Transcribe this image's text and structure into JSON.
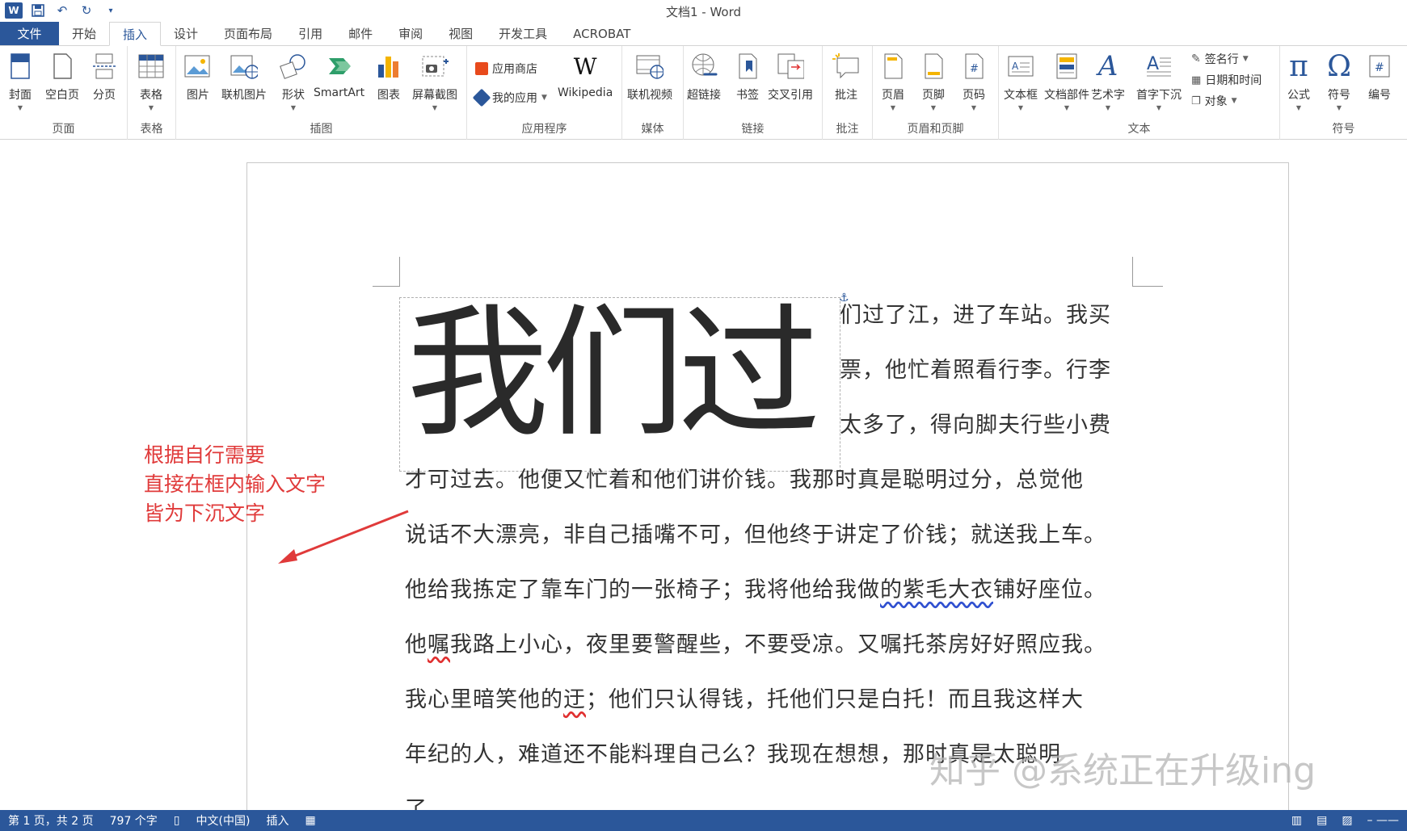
{
  "window": {
    "title": "文档1 - Word"
  },
  "tabs": [
    "文件",
    "开始",
    "插入",
    "设计",
    "页面布局",
    "引用",
    "邮件",
    "审阅",
    "视图",
    "开发工具",
    "ACROBAT"
  ],
  "active_tab": "插入",
  "ribbon": {
    "page_group": {
      "label": "页面",
      "cover": "封面",
      "blank": "空白页",
      "break": "分页"
    },
    "table_group": {
      "label": "表格",
      "table": "表格"
    },
    "illus_group": {
      "label": "插图",
      "picture": "图片",
      "online_picture": "联机图片",
      "shapes": "形状",
      "smartart": "SmartArt",
      "chart": "图表",
      "screenshot": "屏幕截图"
    },
    "apps_group": {
      "label": "应用程序",
      "store": "应用商店",
      "my_apps": "我的应用",
      "wikipedia": "Wikipedia"
    },
    "media_group": {
      "label": "媒体",
      "online_video": "联机视频"
    },
    "links_group": {
      "label": "链接",
      "hyperlink": "超链接",
      "bookmark": "书签",
      "cross_ref": "交叉引用"
    },
    "comments_group": {
      "label": "批注",
      "comment": "批注"
    },
    "hf_group": {
      "label": "页眉和页脚",
      "header": "页眉",
      "footer": "页脚",
      "page_number": "页码"
    },
    "text_group": {
      "label": "文本",
      "textbox": "文本框",
      "quick_parts": "文档部件",
      "wordart": "艺术字",
      "dropcap": "首字下沉",
      "signature": "签名行",
      "datetime": "日期和时间",
      "object": "对象"
    },
    "symbols_group": {
      "label": "符号",
      "equation": "公式",
      "symbol": "符号",
      "number": "编号"
    }
  },
  "document": {
    "dropcap_text": "我们过",
    "lines": [
      "们过了江，进了车站。我买",
      "票，他忙着照看行李。行李",
      "太多了，得向脚夫行些小费",
      "才可过去。他便又忙着和他们讲价钱。我那时真是聪明过分，总觉他",
      "说话不大漂亮，非自己插嘴不可，但他终于讲定了价钱；就送我上车。",
      "他给我拣定了靠车门的一张椅子；我将他给我做",
      "的紫毛大衣",
      "铺好座位。",
      "他",
      "嘱",
      "我路上小心，夜里要警醒些，不要受凉。又嘱托茶房好好照应我。",
      "我心里暗笑他的",
      "迂",
      "；他们只认得钱，托他们只是白托！而且我这样大",
      "年纪的人，难道还不能料理自己么？我现在想想，那时真是太聪明",
      "了。"
    ]
  },
  "annotation": {
    "line1": "根据自行需要",
    "line2": "直接在框内输入文字",
    "line3": "皆为下沉文字"
  },
  "watermark": "知乎 @系统正在升级ing",
  "status": {
    "page": "第 1 页，共 2 页",
    "words": "797 个字",
    "language": "中文(中国)",
    "mode": "插入"
  },
  "colors": {
    "accent": "#2b579a",
    "annotation": "#e03a3a"
  }
}
